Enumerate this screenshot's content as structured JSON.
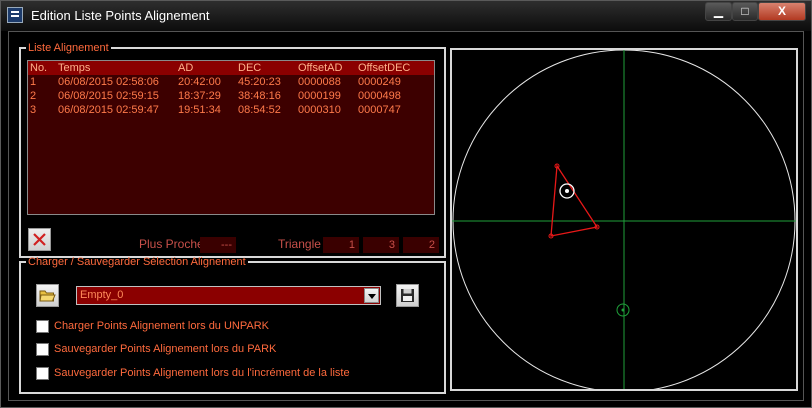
{
  "window": {
    "title": "Edition Liste Points Alignement",
    "controls": {
      "minimize": "▁",
      "maximize": "□",
      "close": "X"
    }
  },
  "list_group": {
    "legend": "Liste Alignement",
    "columns": [
      "No.",
      "Temps",
      "AD",
      "DEC",
      "OffsetAD",
      "OffsetDEC"
    ],
    "rows": [
      [
        "1",
        "06/08/2015 02:58:06",
        "20:42:00",
        "45:20:23",
        "0000088",
        "0000249"
      ],
      [
        "2",
        "06/08/2015 02:59:15",
        "18:37:29",
        "38:48:16",
        "0000199",
        "0000498"
      ],
      [
        "3",
        "06/08/2015 02:59:47",
        "19:51:34",
        "08:54:52",
        "0000310",
        "0000747"
      ]
    ],
    "plus_proche_label": "Plus Proche",
    "plus_proche_value": "---",
    "triangle_label": "Triangle",
    "triangle_values": [
      "1",
      "3",
      "2"
    ]
  },
  "save_group": {
    "legend": "Charger / Sauvegarder Sélection Alignement",
    "combo_value": "Empty_0",
    "checkboxes": [
      {
        "label": "Charger Points Alignement lors du UNPARK",
        "checked": false
      },
      {
        "label": "Sauvegarder Points Alignement lors du PARK",
        "checked": false
      },
      {
        "label": "Sauvegarder Points Alignement lors du l'incrément de la liste",
        "checked": false
      }
    ]
  },
  "colors": {
    "accent_text": "#ff6a3d",
    "list_bg": "#3d0000",
    "header_bg": "#8a0000",
    "plot_circle": "#e8e8e8",
    "plot_axis": "#1fa03a",
    "triangle": "#e81818"
  }
}
